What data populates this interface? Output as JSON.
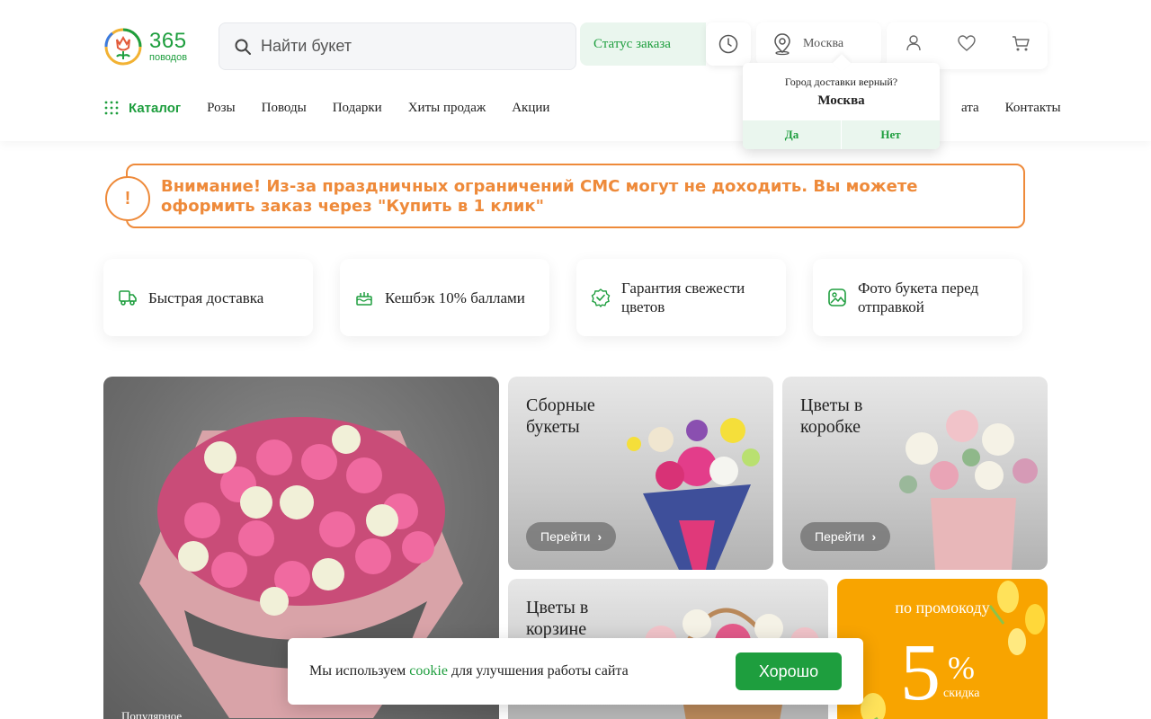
{
  "header": {
    "logo_number": "365",
    "logo_sub": "поводов",
    "search_placeholder": "Найти букет",
    "order_status": "Статус заказа",
    "city": "Москва"
  },
  "nav": {
    "catalog": "Каталог",
    "items": [
      "Розы",
      "Поводы",
      "Подарки",
      "Хиты продаж",
      "Акции"
    ],
    "right_items": [
      "ата",
      "Контакты"
    ]
  },
  "city_popup": {
    "question": "Город доставки верный?",
    "city": "Москва",
    "yes": "Да",
    "no": "Нет"
  },
  "warning": {
    "icon": "!",
    "text": "Внимание! Из-за праздничных ограничений СМС могут не доходить. Вы можете оформить заказ через \"Купить в 1 клик\""
  },
  "features": [
    {
      "label": "Быстрая доставка",
      "icon": "delivery-truck-icon"
    },
    {
      "label": "Кешбэк 10% баллами",
      "icon": "cake-icon"
    },
    {
      "label": "Гарантия свежести цветов",
      "icon": "check-badge-icon"
    },
    {
      "label": "Фото букета перед отправкой",
      "icon": "photo-icon"
    }
  ],
  "banners": {
    "main_label": "Популярное",
    "b1_title": "Сборные букеты",
    "b2_title": "Цветы в коробке",
    "b3_title": "Цветы в корзине",
    "go": "Перейти",
    "promo_title": "по промокоду",
    "promo_number": "5",
    "promo_pct": "%",
    "promo_sub": "скидка"
  },
  "cookie": {
    "text_before": "Мы используем",
    "link": "cookie",
    "text_after": "для улучшения работы сайта",
    "button": "Хорошо"
  },
  "colors": {
    "brand_green": "#1e9e3e",
    "warning_orange": "#ee8a3a",
    "promo_yellow": "#f8a400"
  }
}
